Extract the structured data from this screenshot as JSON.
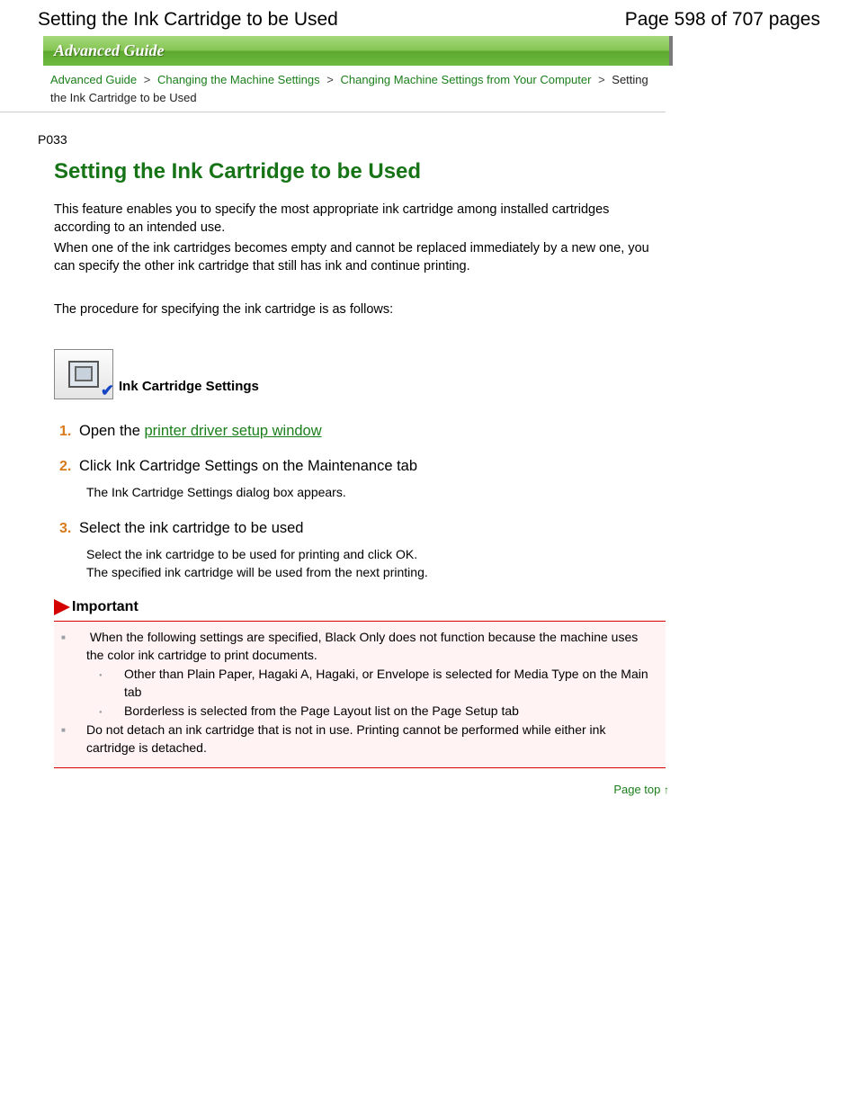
{
  "header": {
    "doc_title": "Setting the Ink Cartridge to be Used",
    "page_number": "Page 598 of 707 pages"
  },
  "banner": "Advanced Guide",
  "breadcrumb": {
    "l1": "Advanced Guide",
    "l2": "Changing the Machine Settings",
    "l3": "Changing Machine Settings from Your Computer",
    "current": "Setting the Ink Cartridge to be Used",
    "sep": ">"
  },
  "page_code": "P033",
  "h1": "Setting the Ink Cartridge to be Used",
  "intro": {
    "p1": "This feature enables you to specify the most appropriate ink cartridge among installed cartridges according to an intended use.",
    "p2": "When one of the ink cartridges becomes empty and cannot be replaced immediately by a new one, you can specify the other ink cartridge that still has ink and continue printing.",
    "p3": "The procedure for specifying the ink cartridge is as follows:"
  },
  "icon_label": "Ink Cartridge Settings",
  "steps": [
    {
      "num": "1.",
      "title_pre": "Open the ",
      "title_link": "printer driver setup window",
      "body": ""
    },
    {
      "num": "2.",
      "title_pre": "Click Ink Cartridge Settings on the Maintenance tab",
      "title_link": "",
      "body": "The Ink Cartridge Settings dialog box appears."
    },
    {
      "num": "3.",
      "title_pre": "Select the ink cartridge to be used",
      "title_link": "",
      "body": "Select the ink cartridge to be used for printing and click OK.\nThe specified ink cartridge will be used from the next printing."
    }
  ],
  "important": {
    "label": "Important",
    "b1": "When the following settings are specified, Black Only does not function because the machine uses the color ink cartridge to print documents.",
    "b1s1": "Other than Plain Paper, Hagaki A, Hagaki, or Envelope is selected for Media Type on the Main tab",
    "b1s2": "Borderless is selected from the Page Layout list on the Page Setup tab",
    "b2": "Do not detach an ink cartridge that is not in use. Printing cannot be performed while either ink cartridge is detached."
  },
  "page_top": "Page top"
}
